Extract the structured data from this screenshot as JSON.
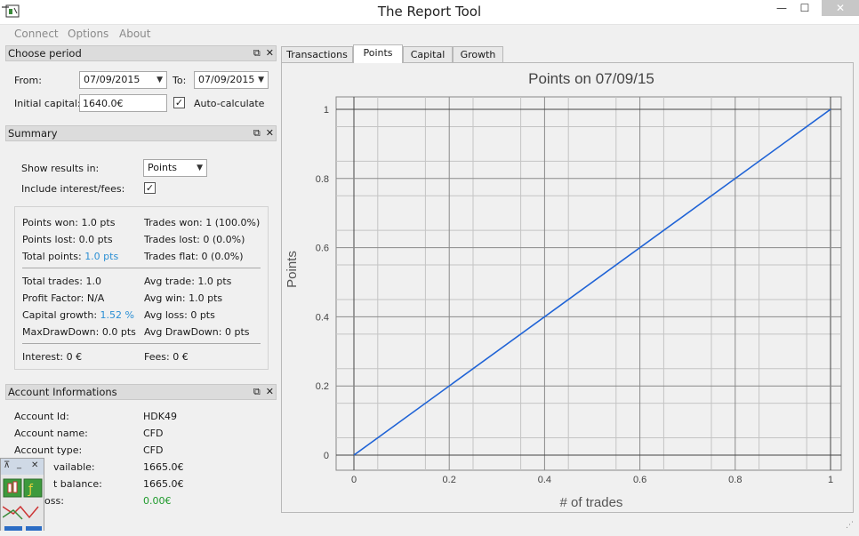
{
  "window": {
    "title": "The Report Tool",
    "min_label": "—",
    "max_label": "☐",
    "close_label": "✕"
  },
  "menu": [
    "Connect",
    "Options",
    "About"
  ],
  "choose_period": {
    "title": "Choose period",
    "from_label": "From:",
    "from_value": "07/09/2015",
    "to_label": "To:",
    "to_value": "07/09/2015",
    "capital_label": "Initial capital:",
    "capital_value": "1640.0€",
    "auto_calc_label": "Auto-calculate",
    "auto_calc_checked": "✓"
  },
  "summary": {
    "title": "Summary",
    "show_results_label": "Show results in:",
    "show_results_value": "Points",
    "include_fees_label": "Include interest/fees:",
    "include_fees_checked": "✓",
    "points_won": "Points won: 1.0 pts",
    "trades_won": "Trades won: 1 (100.0%)",
    "points_lost": "Points lost: 0.0 pts",
    "trades_lost": "Trades lost: 0 (0.0%)",
    "total_points_label": "Total points:",
    "total_points_value": "1.0 pts",
    "trades_flat": "Trades flat: 0 (0.0%)",
    "total_trades": "Total trades: 1.0",
    "avg_trade": "Avg trade: 1.0 pts",
    "profit_factor": "Profit Factor: N/A",
    "avg_win": "Avg win: 1.0 pts",
    "capital_growth_label": "Capital growth:",
    "capital_growth_value": "1.52 %",
    "avg_loss": "Avg loss: 0 pts",
    "max_drawdown": "MaxDrawDown: 0.0 pts",
    "avg_drawdown": "Avg DrawDown: 0 pts",
    "interest": "Interest: 0 €",
    "fees": "Fees: 0 €"
  },
  "account": {
    "title": "Account Informations",
    "rows": [
      {
        "label": "Account Id:",
        "value": "HDK49"
      },
      {
        "label": "Account name:",
        "value": "CFD"
      },
      {
        "label": "Account type:",
        "value": "CFD"
      },
      {
        "label": "vailable:",
        "value": "1665.0€"
      },
      {
        "label": "t balance:",
        "value": "1665.0€"
      },
      {
        "label": "oss:",
        "value": "0.00€"
      }
    ]
  },
  "tabs": [
    "Transactions",
    "Points",
    "Capital",
    "Growth"
  ],
  "active_tab": "Points",
  "colors": {
    "line": "#1f63d6",
    "link_blue": "#2b8fd4",
    "profit_green": "#1f9a2c"
  },
  "chart_data": {
    "type": "line",
    "title": "Points on 07/09/15",
    "xlabel": "# of trades",
    "ylabel": "Points",
    "xlim": [
      0,
      1
    ],
    "ylim": [
      0,
      1
    ],
    "xticks": [
      "0",
      "0.2",
      "0.4",
      "0.6",
      "0.8",
      "1"
    ],
    "yticks": [
      "0",
      "0.2",
      "0.4",
      "0.6",
      "0.8",
      "1"
    ],
    "grid": true,
    "series": [
      {
        "x": [
          0,
          1
        ],
        "y": [
          0,
          1
        ]
      }
    ]
  }
}
